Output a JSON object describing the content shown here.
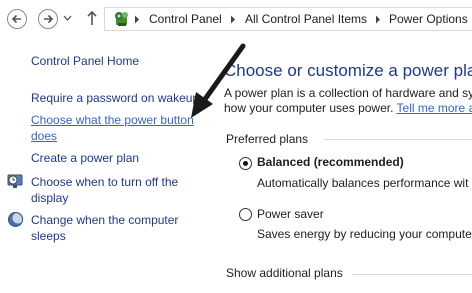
{
  "address_bar": {
    "breadcrumbs": [
      "Control Panel",
      "All Control Panel Items",
      "Power Options"
    ]
  },
  "left_pane": {
    "home": "Control Panel Home",
    "require_password": "Require a password on wakeup",
    "power_button_line1": "Choose what the power button",
    "power_button_line2": "does",
    "create_plan": "Create a power plan",
    "turn_off_line1": "Choose when to turn off the",
    "turn_off_line2": "display",
    "sleep_line1": "Change when the computer",
    "sleep_line2": "sleeps"
  },
  "main": {
    "title": "Choose or customize a power plan",
    "desc_line1": "A power plan is a collection of hardware and sy",
    "desc_line2": "how your computer uses power.",
    "tell_me_more": "Tell me more a",
    "section_title": "Preferred plans",
    "plans": [
      {
        "name": "Balanced (recommended)",
        "description": "Automatically balances performance wit",
        "selected": true
      },
      {
        "name": "Power saver",
        "description": "Saves energy by reducing your computer",
        "selected": false
      }
    ],
    "show_additional": "Show additional plans"
  },
  "colors": {
    "link": "#1e3a8a",
    "link_underlined": "#3366cc",
    "arrow": "#1a1a1a"
  },
  "icons": [
    "back-arrow-icon",
    "forward-arrow-icon",
    "chevron-down-icon",
    "up-arrow-icon",
    "control-panel-icon",
    "clock-monitor-icon",
    "moon-sleep-icon"
  ]
}
